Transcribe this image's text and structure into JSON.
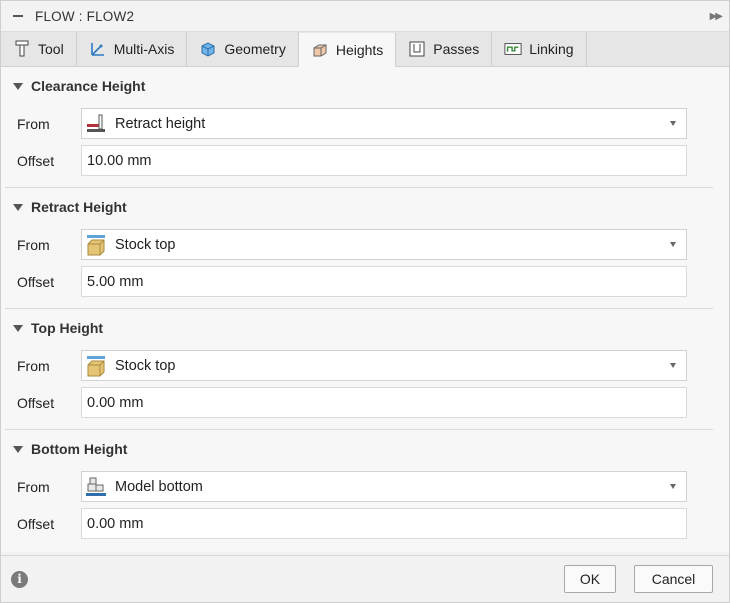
{
  "window": {
    "title": "FLOW : FLOW2"
  },
  "tabs": [
    {
      "label": "Tool",
      "icon": "tool-icon"
    },
    {
      "label": "Multi-Axis",
      "icon": "multi-axis-icon"
    },
    {
      "label": "Geometry",
      "icon": "geometry-icon"
    },
    {
      "label": "Heights",
      "icon": "heights-icon",
      "active": true
    },
    {
      "label": "Passes",
      "icon": "passes-icon"
    },
    {
      "label": "Linking",
      "icon": "linking-icon"
    }
  ],
  "sections": [
    {
      "title": "Clearance Height",
      "from_label": "From",
      "from_value": "Retract height",
      "from_icon": "retract-height-icon",
      "offset_label": "Offset",
      "offset_value": "10.00 mm"
    },
    {
      "title": "Retract Height",
      "from_label": "From",
      "from_value": "Stock top",
      "from_icon": "stock-top-icon",
      "offset_label": "Offset",
      "offset_value": "5.00 mm"
    },
    {
      "title": "Top Height",
      "from_label": "From",
      "from_value": "Stock top",
      "from_icon": "stock-top-icon",
      "offset_label": "Offset",
      "offset_value": "0.00 mm"
    },
    {
      "title": "Bottom Height",
      "from_label": "From",
      "from_value": "Model bottom",
      "from_icon": "model-bottom-icon",
      "offset_label": "Offset",
      "offset_value": "0.00 mm"
    }
  ],
  "footer": {
    "ok_label": "OK",
    "cancel_label": "Cancel",
    "info_glyph": "i"
  },
  "colors": {
    "accent_red": "#b5333a",
    "stock_tan": "#e6c476",
    "stock_blue": "#5fa3d9",
    "model_blue": "#2f6fae"
  }
}
